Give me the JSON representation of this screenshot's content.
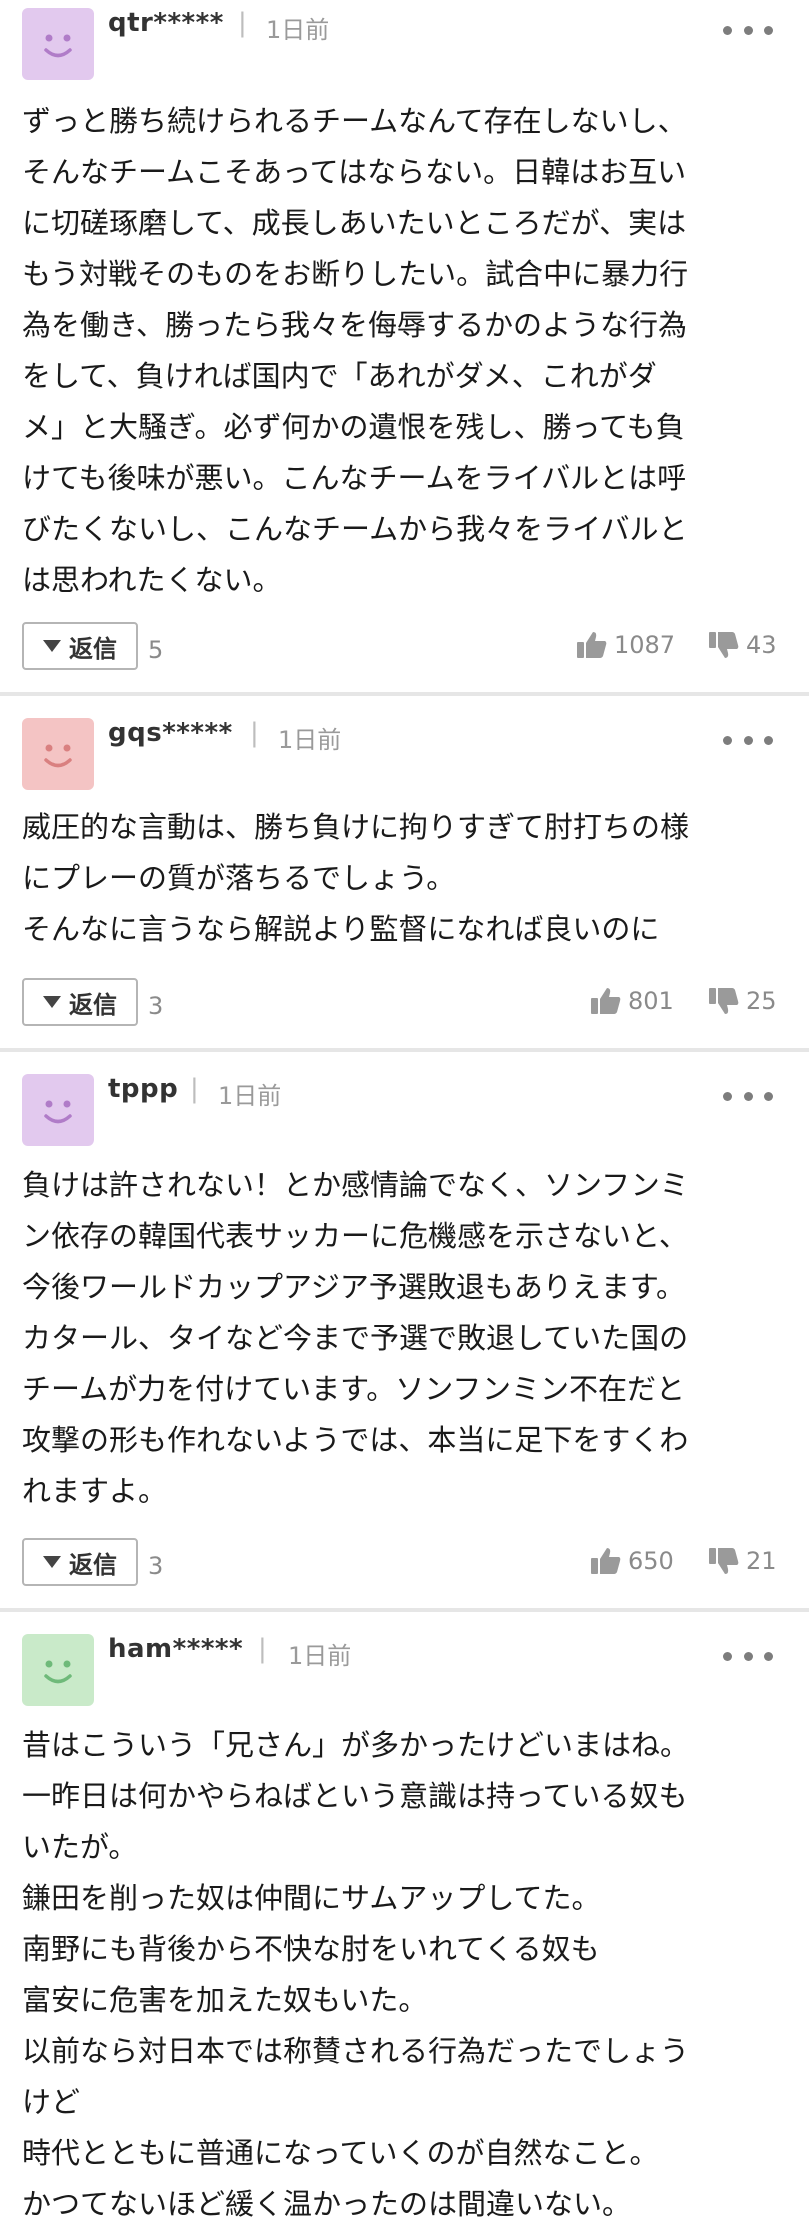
{
  "colors": {
    "avatar_purple": "#e2c9ee",
    "avatar_purple_face": "#b07cc8",
    "avatar_pink": "#f4c4c4",
    "avatar_pink_face": "#d98080",
    "avatar_green": "#c9eac9",
    "avatar_green_face": "#6fba7a",
    "icon_gray": "#9a9a9a"
  },
  "reply_label": "返信",
  "comments": [
    {
      "username": "qtr*****",
      "time": "1日前",
      "avatar_color": "purple",
      "text": "ずっと勝ち続けられるチームなんて存在しないし、\nそんなチームこそあってはならない。日韓はお互い\nに切磋琢磨して、成長しあいたいところだが、実は\nもう対戦そのものをお断りしたい。試合中に暴力行\n為を働き、勝ったら我々を侮辱するかのような行為\nをして、負ければ国内で「あれがダメ、これがダ\nメ」と大騒ぎ。必ず何かの遺恨を残し、勝っても負\nけても後味が悪い。こんなチームをライバルとは呼\nびたくないし、こんなチームから我々をライバルと\nは思われたくない。",
      "replies": "5",
      "likes": "1087",
      "dislikes": "43"
    },
    {
      "username": "gqs*****",
      "time": "1日前",
      "avatar_color": "pink",
      "text": "威圧的な言動は、勝ち負けに拘りすぎて肘打ちの様\nにプレーの質が落ちるでしょう。\nそんなに言うなら解説より監督になれば良いのに",
      "replies": "3",
      "likes": "801",
      "dislikes": "25"
    },
    {
      "username": "tppp",
      "time": "1日前",
      "avatar_color": "purple",
      "text": "負けは許されない！とか感情論でなく、ソンフンミ\nン依存の韓国代表サッカーに危機感を示さないと、\n今後ワールドカップアジア予選敗退もありえます。\nカタール、タイなど今まで予選で敗退していた国の\nチームが力を付けています。ソンフンミン不在だと\n攻撃の形も作れないようでは、本当に足下をすくわ\nれますよ。",
      "replies": "3",
      "likes": "650",
      "dislikes": "21"
    },
    {
      "username": "ham*****",
      "time": "1日前",
      "avatar_color": "green",
      "text": "昔はこういう「兄さん」が多かったけどいまはね。\n一昨日は何かやらねばという意識は持っている奴も\nいたが。\n鎌田を削った奴は仲間にサムアップしてた。\n南野にも背後から不快な肘をいれてくる奴も\n富安に危害を加えた奴もいた。\n以前なら対日本では称賛される行為だったでしょう\nけど\n時代とともに普通になっていくのが自然なこと。\nかつてないほど緩く温かったのは間違いない。"
    }
  ]
}
